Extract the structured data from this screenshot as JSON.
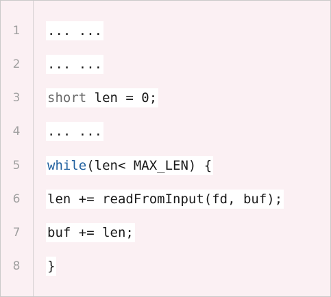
{
  "editor": {
    "lines": [
      {
        "number": "1",
        "parts": [
          {
            "text": "... ...",
            "kind": "plain"
          }
        ]
      },
      {
        "number": "2",
        "parts": [
          {
            "text": "... ...",
            "kind": "plain"
          }
        ]
      },
      {
        "number": "3",
        "parts": [
          {
            "text": "short",
            "kind": "type"
          },
          {
            "text": " len = 0;",
            "kind": "plain"
          }
        ]
      },
      {
        "number": "4",
        "parts": [
          {
            "text": "... ...",
            "kind": "plain"
          }
        ]
      },
      {
        "number": "5",
        "parts": [
          {
            "text": "while",
            "kind": "control"
          },
          {
            "text": "(len< MAX_LEN) {",
            "kind": "plain"
          }
        ]
      },
      {
        "number": "6",
        "parts": [
          {
            "text": "len += readFromInput(fd, buf);",
            "kind": "plain"
          }
        ]
      },
      {
        "number": "7",
        "parts": [
          {
            "text": "buf += len;",
            "kind": "plain"
          }
        ]
      },
      {
        "number": "8",
        "parts": [
          {
            "text": "}",
            "kind": "plain"
          }
        ]
      }
    ]
  },
  "colors": {
    "background": "#fbf0f3",
    "code_highlight": "#ffffff",
    "line_number": "#a0a0a0",
    "type_keyword": "#6a6a6a",
    "control_keyword": "#1f5f9e"
  }
}
